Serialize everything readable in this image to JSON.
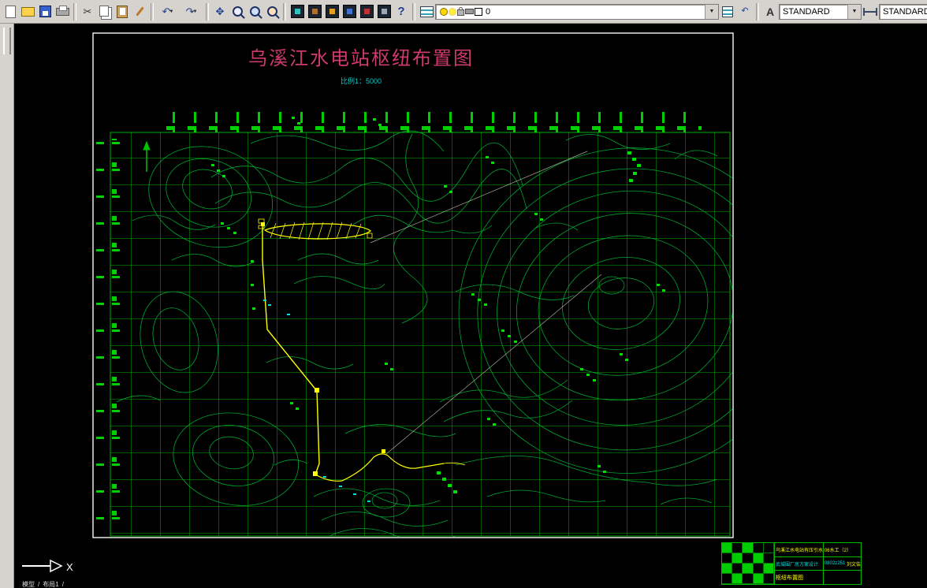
{
  "toolbar": {
    "layer_value": "0",
    "text_style_value": "STANDARD",
    "dim_style_value": "STANDARD",
    "glyphs": {
      "cut": "✂",
      "undo": "↶",
      "redo": "↷",
      "pan": "✥",
      "help": "?",
      "arrow": "▼",
      "text_style": "A"
    }
  },
  "drawing": {
    "title": "乌溪江水电站枢纽布置图",
    "scale_label": "比例1：5000",
    "colors": {
      "title": "#cd3a6b",
      "subtitle": "#00cfcf",
      "grid": "#00b000",
      "contour": "#00a332",
      "marker": "#00e000",
      "feature": "#ffff00",
      "frame": "#e8e8e8"
    }
  },
  "title_block": {
    "project": "乌溪江水电站有压引水",
    "design": "武城围厂房方案设计",
    "sheet": "枢纽布置图",
    "class": "06水工（2）",
    "student_id": "0802z251",
    "name": "刘文佶"
  },
  "ucs": {
    "x": "X"
  },
  "tabs": {
    "model": "模型",
    "layout1": "布局1"
  }
}
